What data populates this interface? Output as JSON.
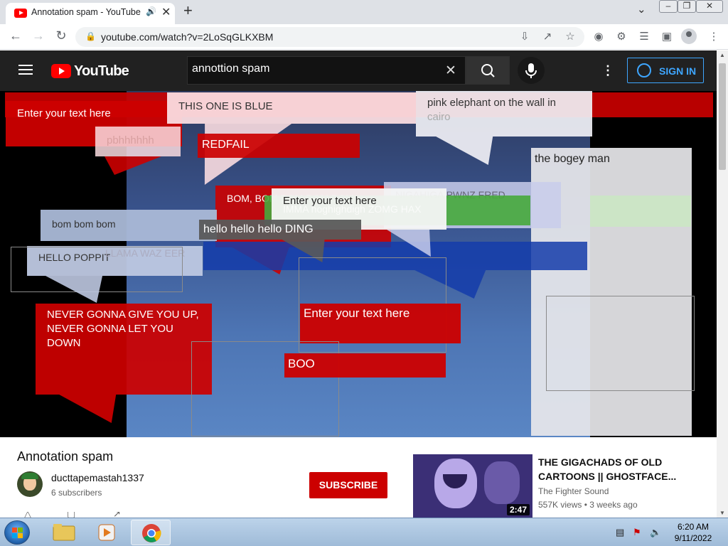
{
  "browser": {
    "tab_title": "Annotation spam - YouTube",
    "url": "youtube.com/watch?v=2LoSqGLKXBM",
    "icons": [
      "back-icon",
      "forward-icon",
      "reload-icon",
      "lock-icon",
      "install-icon",
      "share-icon",
      "star-icon",
      "extensions-icon",
      "media-icon",
      "sidepanel-icon",
      "profile-icon"
    ]
  },
  "youtube": {
    "logo_text": "YouTube",
    "search_value": "annottion spam",
    "sign_in": "SIGN IN"
  },
  "annotations": {
    "a1": "Enter your text here",
    "a2": "THIS ONE IS BLUE",
    "a3": "pink elephant on the wall in",
    "a3b": "cairo",
    "a4": "pbhhhhhh",
    "a5": "REDFAIL",
    "a6": "the bogey man",
    "a7": "BOM, BOM BOM BOM BOM",
    "a8": "Enter your text here",
    "a9": "NIGAHIGA PWNZ FRED",
    "a10": "IMMA hoghighdigh ZOMG HAX",
    "a11": "bom bom bom",
    "a12": "hello hello hello DING",
    "a13": "LLAMA WAZ EER",
    "a14": "HELLO POPPIT",
    "a15": "NEVER GONNA GIVE YOU UP, NEVER GONNA LET YOU DOWN",
    "a16": "Enter your text here",
    "a17": "BOO"
  },
  "video": {
    "title": "Annotation spam",
    "channel": "ducttapemastah1337",
    "subscribers": "6 subscribers",
    "subscribe": "SUBSCRIBE"
  },
  "related": {
    "title": "THE GIGACHADS OF OLD CARTOONS || GHOSTFACE...",
    "channel": "The Fighter Sound",
    "meta": "557K views • 3 weeks ago",
    "duration": "2:47"
  },
  "taskbar": {
    "time": "6:20 AM",
    "date": "9/11/2022"
  }
}
